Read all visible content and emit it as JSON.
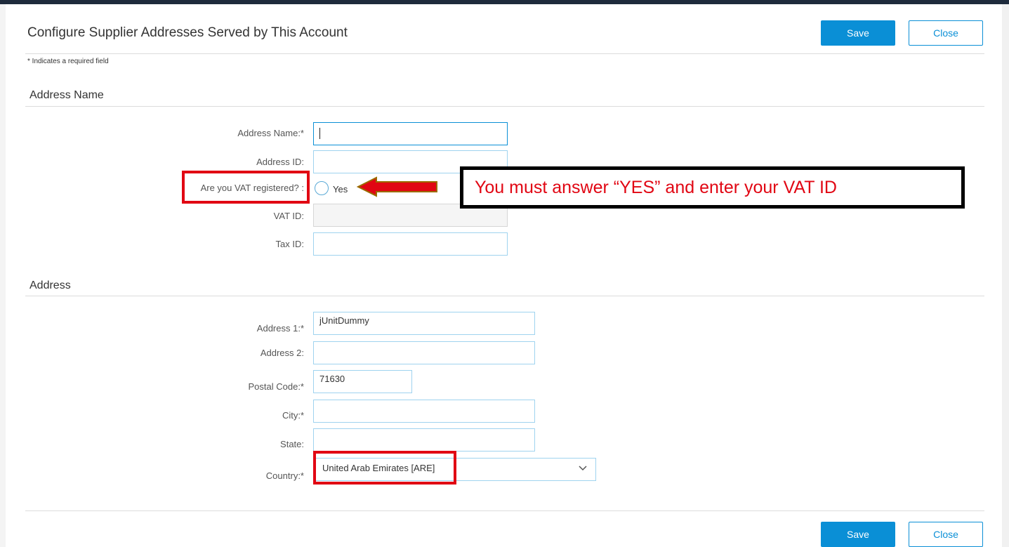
{
  "header": {
    "title": "Configure Supplier Addresses Served by This Account",
    "save_label": "Save",
    "close_label": "Close",
    "required_note": "* Indicates a required field"
  },
  "address_name_section": {
    "title": "Address Name",
    "address_name_label": "Address Name:*",
    "address_name_value": "",
    "address_id_label": "Address ID:",
    "address_id_value": "",
    "vat_question_label": "Are you VAT registered? :",
    "vat_yes_label": "Yes",
    "vat_id_label": "VAT ID:",
    "vat_id_value": "",
    "tax_id_label": "Tax ID:",
    "tax_id_value": ""
  },
  "address_section": {
    "title": "Address",
    "address1_label": "Address 1:*",
    "address1_value": "jUnitDummy",
    "address2_label": "Address 2:",
    "address2_value": "",
    "postal_code_label": "Postal Code:*",
    "postal_code_value": "71630",
    "city_label": "City:*",
    "city_value": "",
    "state_label": "State:",
    "state_value": "",
    "country_label": "Country:*",
    "country_value": "United Arab Emirates  [ARE]"
  },
  "annotation": {
    "callout_text": "You must answer “YES” and enter your VAT ID",
    "highlight_color": "#e10613"
  },
  "footer": {
    "save_label": "Save",
    "close_label": "Close"
  },
  "colors": {
    "accent": "#0a8fd6",
    "header_bar": "#1e2b3c"
  }
}
